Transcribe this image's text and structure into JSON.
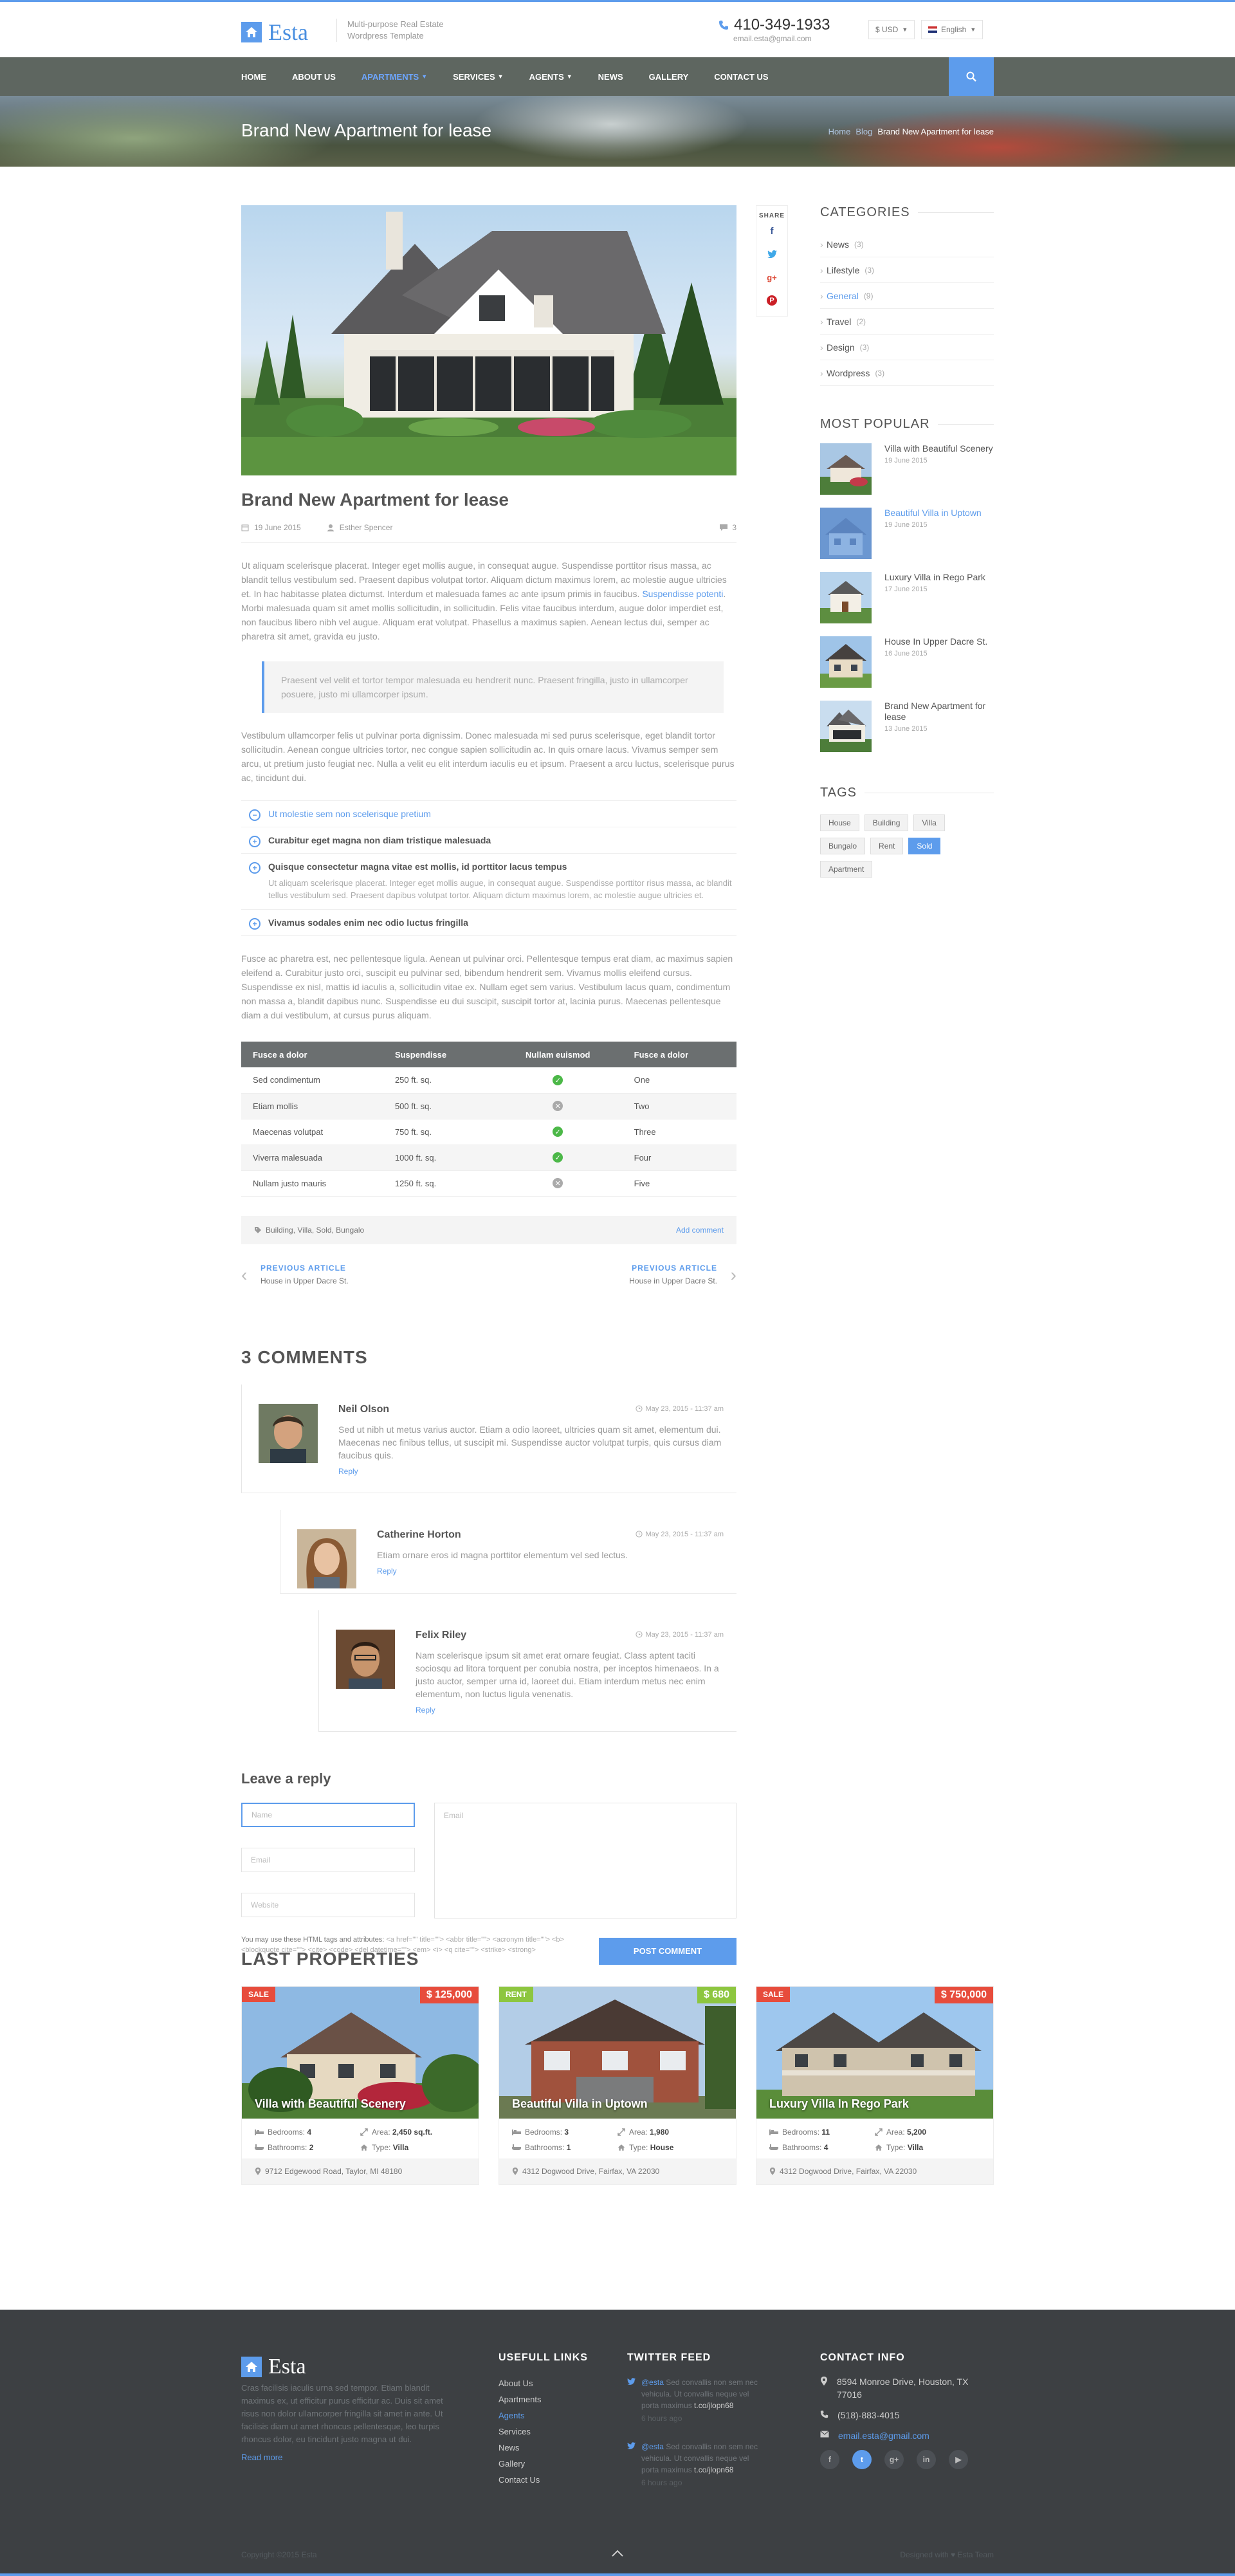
{
  "header": {
    "logo": "Esta",
    "tagline": "Multi-purpose Real Estate Wordpress Template",
    "phone": "410-349-1933",
    "email": "email.esta@gmail.com",
    "currency": "$ USD",
    "language": "English"
  },
  "nav": {
    "items": [
      "HOME",
      "ABOUT US",
      "APARTMENTS",
      "SERVICES",
      "AGENTS",
      "NEWS",
      "GALLERY",
      "CONTACT US"
    ],
    "active": "APARTMENTS"
  },
  "hero": {
    "title": "Brand New Apartment for lease",
    "crumbs": [
      "Home",
      "Blog",
      "Brand New Apartment for lease"
    ]
  },
  "post": {
    "title": "Brand New Apartment for lease",
    "date": "19 June 2015",
    "author": "Esther Spencer",
    "comments": "3",
    "p1a": "Ut aliquam scelerisque placerat. Integer eget mollis augue, in consequat augue. Suspendisse porttitor risus massa, ac blandit tellus vestibulum sed. Praesent dapibus volutpat tortor. Aliquam dictum maximus lorem, ac molestie augue ultricies et. In hac habitasse platea dictumst. Interdum et malesuada fames ac ante ipsum primis in faucibus. ",
    "p1link": "Suspendisse potenti",
    "p1b": ". Morbi malesuada quam sit amet mollis sollicitudin, in sollicitudin. Felis vitae faucibus interdum, augue dolor imperdiet est, non faucibus libero nibh vel augue. Aliquam erat volutpat. Phasellus a maximus sapien. Aenean lectus dui, semper ac pharetra sit amet, gravida eu justo.",
    "quote": "Praesent vel velit et tortor tempor malesuada eu hendrerit nunc. Praesent fringilla, justo in ullamcorper posuere, justo mi ullamcorper ipsum.",
    "p2": "Vestibulum ullamcorper felis ut pulvinar porta dignissim. Donec malesuada mi sed purus scelerisque, eget blandit tortor sollicitudin. Aenean congue ultricies tortor, nec congue sapien sollicitudin ac. In quis ornare lacus. Vivamus semper sem arcu, ut pretium justo feugiat nec. Nulla a velit eu elit interdum iaculis eu et ipsum. Praesent a arcu luctus, scelerisque purus ac, tincidunt dui.",
    "accordion": [
      {
        "title": "Ut molestie sem non scelerisque pretium",
        "body": ""
      },
      {
        "title": "Curabitur eget magna non diam tristique malesuada",
        "body": ""
      },
      {
        "title": "Quisque consectetur magna vitae est mollis, id porttitor lacus tempus",
        "body": "Ut aliquam scelerisque placerat. Integer eget mollis augue, in consequat augue. Suspendisse porttitor risus massa, ac blandit tellus vestibulum sed. Praesent dapibus volutpat tortor. Aliquam dictum maximus lorem, ac molestie augue ultricies et."
      },
      {
        "title": "Vivamus sodales enim nec odio luctus fringilla",
        "body": ""
      }
    ],
    "p3": "Fusce ac pharetra est, nec pellentesque ligula. Aenean ut pulvinar orci. Pellentesque tempus erat diam, ac maximus sapien eleifend a. Curabitur justo orci, suscipit eu pulvinar sed, bibendum hendrerit sem. Vivamus mollis eleifend cursus. Suspendisse ex nisl, mattis id iaculis a, sollicitudin vitae ex. Nullam eget sem varius. Vestibulum lacus quam, condimentum non massa a, blandit dapibus nunc. Suspendisse eu dui suscipit, suscipit tortor at, lacinia purus. Maecenas pellentesque diam a dui vestibulum, at cursus purus aliquam.",
    "table": {
      "headers": [
        "Fusce a dolor",
        "Suspendisse",
        "Nullam euismod",
        "Fusce a dolor"
      ],
      "rows": [
        {
          "a": "Sed condimentum",
          "b": "250 ft. sq.",
          "ok": true,
          "d": "One"
        },
        {
          "a": "Etiam mollis",
          "b": "500 ft. sq.",
          "ok": false,
          "d": "Two"
        },
        {
          "a": "Maecenas volutpat",
          "b": "750 ft. sq.",
          "ok": true,
          "d": "Three"
        },
        {
          "a": "Viverra malesuada",
          "b": "1000 ft. sq.",
          "ok": true,
          "d": "Four"
        },
        {
          "a": "Nullam justo mauris",
          "b": "1250 ft. sq.",
          "ok": false,
          "d": "Five"
        }
      ]
    },
    "tags_line": "Building, Villa, Sold, Bungalo",
    "add_comment": "Add comment",
    "prev_label": "PREVIOUS ARTICLE",
    "prev_title": "House in Upper Dacre St.",
    "next_label": "PREVIOUS ARTICLE",
    "next_title": "House in Upper Dacre St."
  },
  "share": {
    "label": "SHARE"
  },
  "comments": {
    "title": "3 COMMENTS",
    "items": [
      {
        "name": "Neil Olson",
        "date": "May 23, 2015 - 11:37 am",
        "text": "Sed ut nibh ut metus varius auctor. Etiam a odio laoreet, ultricies quam sit amet, elementum dui. Maecenas nec finibus tellus, ut suscipit mi. Suspendisse auctor volutpat turpis, quis cursus diam faucibus quis.",
        "reply": "Reply"
      },
      {
        "name": "Catherine Horton",
        "date": "May 23, 2015 - 11:37 am",
        "text": "Etiam ornare eros id magna porttitor elementum vel sed lectus.",
        "reply": "Reply"
      },
      {
        "name": "Felix Riley",
        "date": "May 23, 2015 - 11:37 am",
        "text": "Nam scelerisque ipsum sit amet erat ornare feugiat. Class aptent taciti sociosqu ad litora torquent per conubia nostra, per inceptos himenaeos. In a justo auctor, semper urna id, laoreet dui. Etiam interdum metus nec enim elementum, non luctus ligula venenatis.",
        "reply": "Reply"
      }
    ]
  },
  "reply": {
    "title": "Leave a reply",
    "name_ph": "Name",
    "email_ph": "Email",
    "website_ph": "Website",
    "message_ph": "Email",
    "note": "You may use these HTML tags and attributes:",
    "note_tags": "<a href=\"\" title=\"\"> <abbr title=\"\"> <acronym title=\"\"> <b> <blockquote cite=\"\"> <cite> <code> <del datetime=\"\"> <em> <i> <q cite=\"\"> <strike> <strong>",
    "button": "POST COMMENT"
  },
  "sidebar": {
    "categories_title": "CATEGORIES",
    "categories": [
      {
        "name": "News",
        "count": "(3)"
      },
      {
        "name": "Lifestyle",
        "count": "(3)"
      },
      {
        "name": "General",
        "count": "(9)"
      },
      {
        "name": "Travel",
        "count": "(2)"
      },
      {
        "name": "Design",
        "count": "(3)"
      },
      {
        "name": "Wordpress",
        "count": "(3)"
      }
    ],
    "popular_title": "MOST POPULAR",
    "popular": [
      {
        "title": "Villa with Beautiful Scenery",
        "date": "19 June 2015"
      },
      {
        "title": "Beautiful Villa in Uptown",
        "date": "19 June 2015"
      },
      {
        "title": "Luxury Villa in Rego Park",
        "date": "17 June 2015"
      },
      {
        "title": "House In Upper Dacre St.",
        "date": "16 June 2015"
      },
      {
        "title": "Brand New Apartment for lease",
        "date": "13 June 2015"
      }
    ],
    "tags_title": "TAGS",
    "tags": [
      "House",
      "Building",
      "Villa",
      "Bungalo",
      "Rent",
      "Sold",
      "Apartment"
    ]
  },
  "last_properties": {
    "title": "LAST PROPERTIES",
    "cards": [
      {
        "badge": "SALE",
        "price": "$ 125,000",
        "title": "Villa with Beautiful Scenery",
        "bedrooms": "4",
        "area": "2,450 sq.ft.",
        "bathrooms": "2",
        "type": "Villa",
        "address": "9712 Edgewood Road, Taylor, MI 48180",
        "bl_bedrooms": "Bedrooms:",
        "bl_area": "Area:",
        "bl_bathrooms": "Bathrooms:",
        "bl_type": "Type:"
      },
      {
        "badge": "RENT",
        "price": "$ 680",
        "title": "Beautiful Villa in Uptown",
        "bedrooms": "3",
        "area": "1,980",
        "bathrooms": "1",
        "type": "House",
        "address": "4312 Dogwood Drive, Fairfax, VA 22030",
        "bl_bedrooms": "Bedrooms:",
        "bl_area": "Area:",
        "bl_bathrooms": "Bathrooms:",
        "bl_type": "Type:"
      },
      {
        "badge": "SALE",
        "price": "$ 750,000",
        "title": "Luxury Villa In Rego Park",
        "bedrooms": "11",
        "area": "5,200",
        "bathrooms": "4",
        "type": "Villa",
        "address": "4312 Dogwood Drive, Fairfax, VA 22030",
        "bl_bedrooms": "Bedrooms:",
        "bl_area": "Area:",
        "bl_bathrooms": "Bathrooms:",
        "bl_type": "Type:"
      }
    ]
  },
  "footer": {
    "logo": "Esta",
    "about": "Cras facilisis iaculis urna sed tempor. Etiam blandit maximus ex, ut efficitur purus efficitur ac. Duis sit amet risus non dolor ullamcorper fringilla sit amet in ante. Ut facilisis diam ut amet rhoncus pellentesque, leo turpis rhoncus dolor, eu tincidunt justo magna ut dui.",
    "read_more": "Read more",
    "links_title": "USEFULL LINKS",
    "links": [
      "About Us",
      "Apartments",
      "Agents",
      "Services",
      "News",
      "Gallery",
      "Contact Us"
    ],
    "twitter_title": "TWITTER FEED",
    "tweets": [
      {
        "user": "@esta",
        "text": "Sed convallis non sem nec vehicula. Ut convallis neque vel porta maximus",
        "link": "t.co/jlopn68",
        "ago": "6 hours ago"
      },
      {
        "user": "@esta",
        "text": "Sed convallis non sem nec vehicula. Ut convallis neque vel porta maximus",
        "link": "t.co/jlopn68",
        "ago": "6 hours ago"
      }
    ],
    "contact_title": "CONTACT INFO",
    "address": "8594 Monroe Drive, Houston, TX 77016",
    "phone": "(518)-883-4015",
    "email": "email.esta@gmail.com",
    "copyright": "Copyright ©2015 Esta",
    "credit": "Designed with ♥ Esta Team"
  }
}
